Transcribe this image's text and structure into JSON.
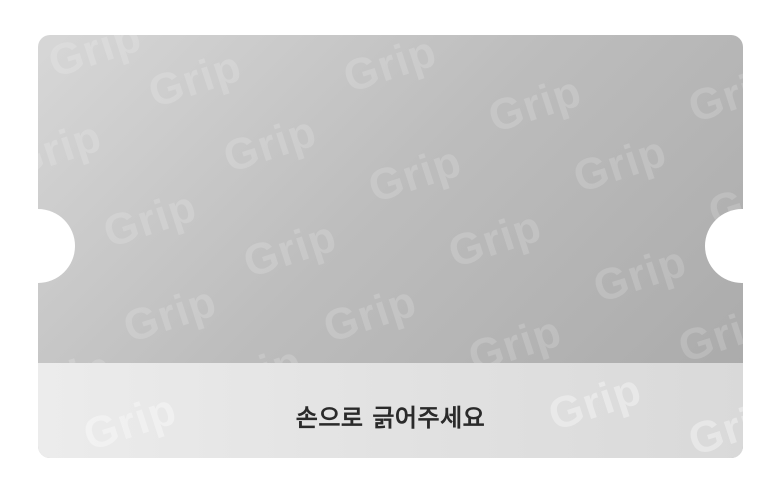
{
  "card": {
    "watermark_text": "Grip",
    "footer_label": "손으로 긁어주세요"
  }
}
